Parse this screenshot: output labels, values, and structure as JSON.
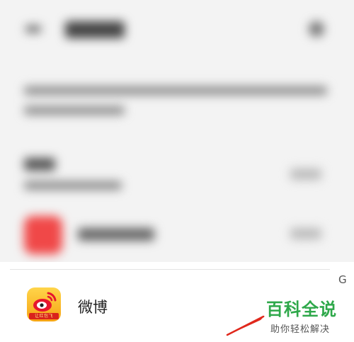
{
  "app_item": {
    "name": "微博",
    "icon": "weibo-icon",
    "icon_tag": "让红包飞"
  },
  "edge_letter": "G",
  "watermark": {
    "title": "百科全说",
    "subtitle": "助你轻松解决"
  },
  "colors": {
    "watermark_green": "#2ea84a",
    "weibo_red": "#e6162d",
    "weibo_yellow": "#f6a313",
    "arrow_red": "#e0281c"
  }
}
